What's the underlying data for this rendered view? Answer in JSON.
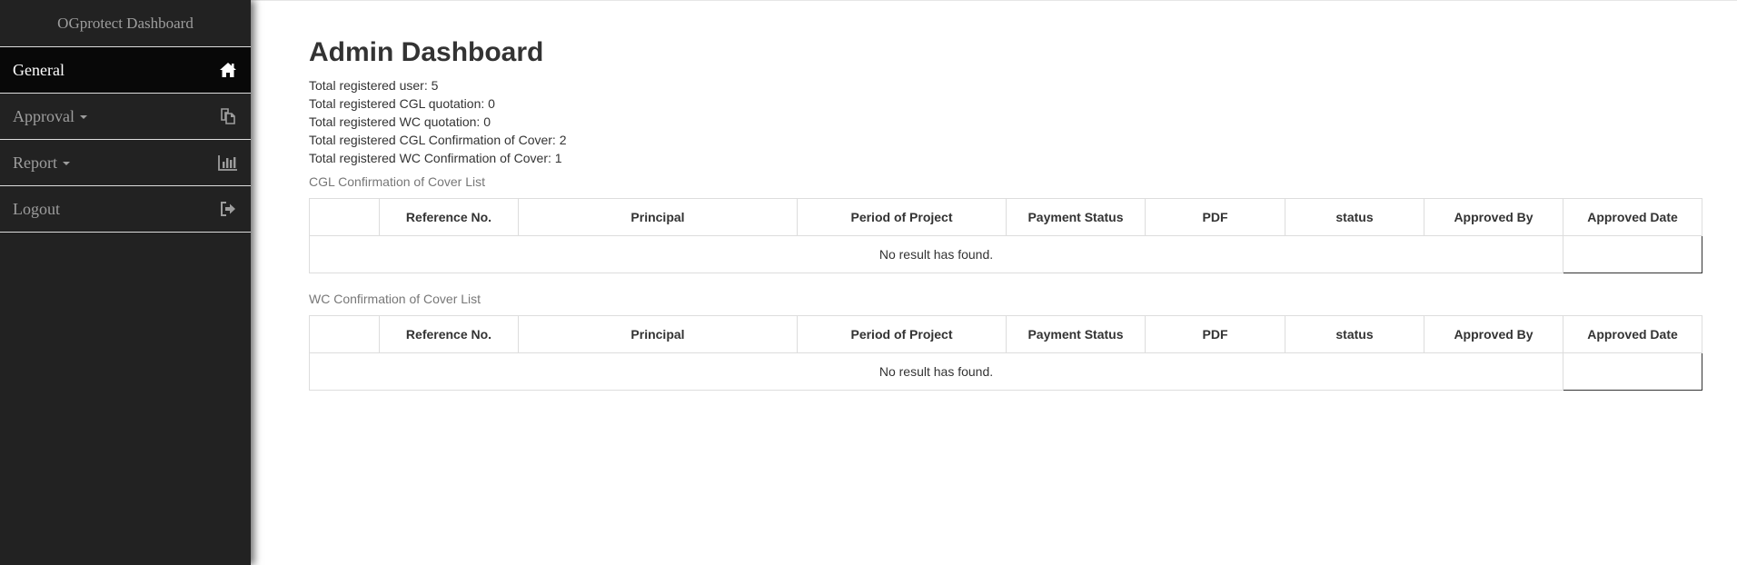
{
  "sidebar": {
    "brand": "OGprotect Dashboard",
    "items": [
      {
        "label": "General",
        "icon": "home-icon",
        "active": true
      },
      {
        "label": "Approval",
        "icon": "copy-icon",
        "dropdown": true
      },
      {
        "label": "Report",
        "icon": "bar-chart-icon",
        "dropdown": true
      },
      {
        "label": "Logout",
        "icon": "logout-icon"
      }
    ]
  },
  "main": {
    "title": "Admin Dashboard",
    "stats": [
      "Total registered user: 5",
      "Total registered CGL quotation: 0",
      "Total registered WC quotation: 0",
      "Total registered CGL Confirmation of Cover: 2",
      "Total registered WC Confirmation of Cover: 1"
    ],
    "cgl": {
      "caption": "CGL Confirmation of Cover List",
      "columns": [
        "",
        "Reference No.",
        "Principal",
        "Period of Project",
        "Payment Status",
        "PDF",
        "status",
        "Approved By",
        "Approved Date"
      ],
      "empty_message": "No result has found."
    },
    "wc": {
      "caption": "WC Confirmation of Cover List",
      "columns": [
        "",
        "Reference No.",
        "Principal",
        "Period of Project",
        "Payment Status",
        "PDF",
        "status",
        "Approved By",
        "Approved Date"
      ],
      "empty_message": "No result has found."
    }
  }
}
